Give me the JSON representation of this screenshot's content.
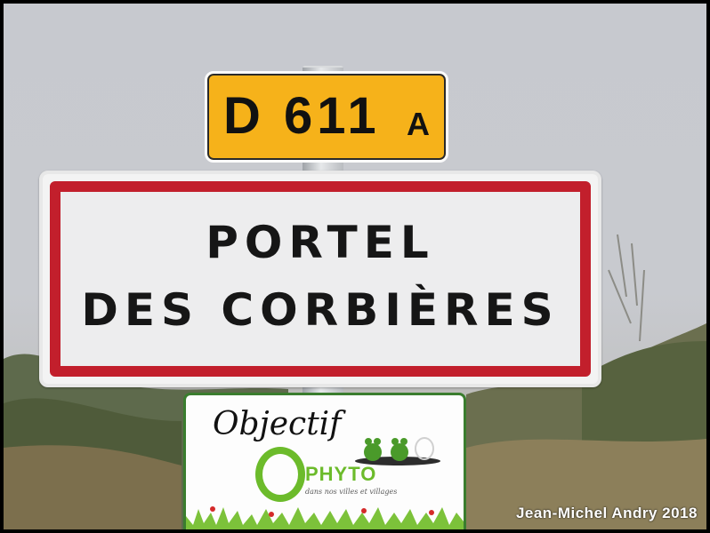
{
  "road_sign": {
    "number": "D 611",
    "suffix": "A"
  },
  "town_sign": {
    "line1": "PORTEL",
    "line2": "DES CORBIÈRES"
  },
  "phyto_panel": {
    "title": "Objectif",
    "word": "PHYTO",
    "tagline": "dans nos villes et villages"
  },
  "credit": "Jean-Michel Andry 2018",
  "colors": {
    "road_sign_yellow": "#f6b21a",
    "town_sign_border_red": "#c21f2c",
    "phyto_green": "#6cbb2b",
    "sky_fog": "#c7c9cf"
  }
}
